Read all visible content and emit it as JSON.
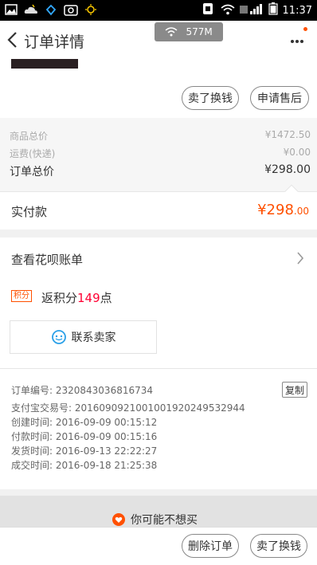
{
  "status_bar": {
    "time": "11:37"
  },
  "nav": {
    "title": "订单详情",
    "memory": "577M"
  },
  "top_actions": {
    "sell_exchange": "卖了换钱",
    "apply_after_sale": "申请售后"
  },
  "price": {
    "goods_total_label": "商品总价",
    "goods_total_value": "¥1472.50",
    "shipping_label": "运费(快递)",
    "shipping_value": "¥0.00",
    "order_total_label": "订单总价",
    "order_total_value": "¥298.00",
    "paid_label": "实付款",
    "paid_main": "¥298",
    "paid_decimal": ".00"
  },
  "huabei": {
    "label": "查看花呗账单"
  },
  "points": {
    "badge": "积分",
    "prefix": "返积分",
    "amount": "149",
    "suffix": "点"
  },
  "contact": {
    "label": "联系卖家"
  },
  "order_info": {
    "order_no": "订单编号: 2320843036816734",
    "alipay_no": "支付宝交易号: 2016090921001001920249532944",
    "created": "创建时间: 2016-09-09 00:15:12",
    "paid": "付款时间: 2016-09-09 00:15:16",
    "shipped": "发货时间: 2016-09-13 22:22:27",
    "completed": "成交时间: 2016-09-18 21:25:38",
    "copy_label": "复制"
  },
  "recommend": {
    "title": "你可能不想买"
  },
  "bottom_actions": {
    "delete_order": "删除订单",
    "sell_exchange": "卖了换钱"
  },
  "colors": {
    "accent": "#ff5000",
    "points_red": "#ff0033"
  }
}
